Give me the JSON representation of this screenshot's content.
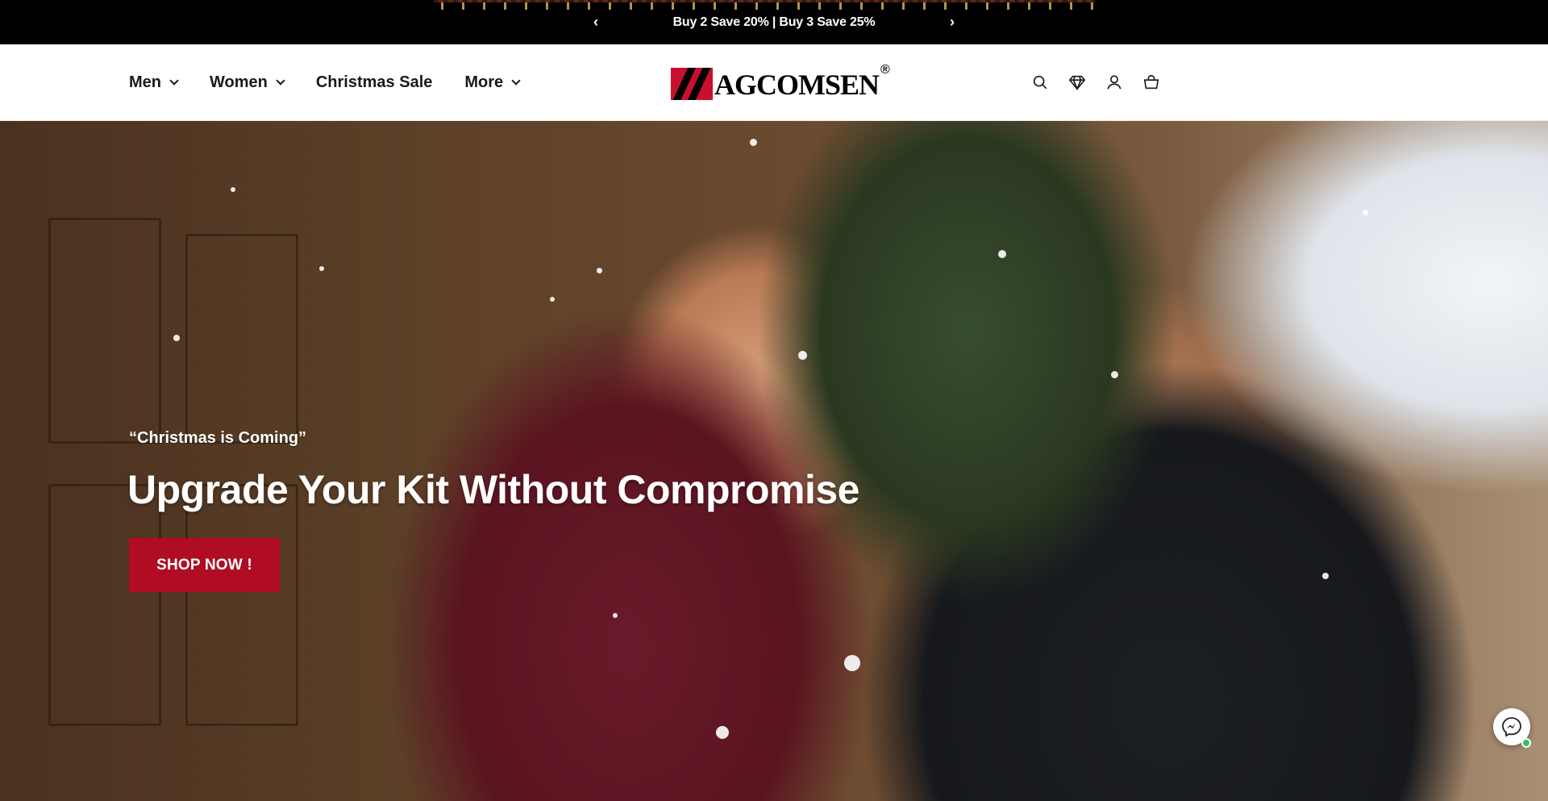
{
  "announcement": {
    "text": "Buy 2 Save 20% | Buy 3 Save 25%",
    "prev_icon": "chevron-left-icon",
    "next_icon": "chevron-right-icon",
    "prev_glyph": "‹",
    "next_glyph": "›"
  },
  "header": {
    "nav": [
      {
        "label": "Men",
        "has_dropdown": true
      },
      {
        "label": "Women",
        "has_dropdown": true
      },
      {
        "label": "Christmas Sale",
        "has_dropdown": false
      },
      {
        "label": "More",
        "has_dropdown": true
      }
    ],
    "logo": {
      "text": "AGCOMSEN",
      "registered": "®",
      "brand_color": "#c8102e"
    },
    "icons": [
      "search-icon",
      "diamond-icon",
      "account-icon",
      "cart-icon"
    ]
  },
  "hero": {
    "quote": "“Christmas is Coming”",
    "title": "Upgrade Your Kit Without Compromise",
    "cta_label": "SHOP NOW !",
    "cta_color": "#b00c24"
  },
  "chat": {
    "icon": "messenger-icon",
    "status": "online",
    "status_color": "#2ec45a"
  }
}
